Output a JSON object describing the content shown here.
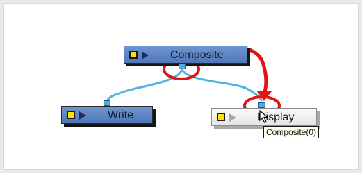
{
  "nodes": {
    "composite": {
      "label": "Composite"
    },
    "write": {
      "label": "Write"
    },
    "display": {
      "label": "Display"
    }
  },
  "tooltip": {
    "text": "Composite(0)"
  },
  "colors": {
    "node_blue": "#5b82c4",
    "node_light": "#f2f2f2",
    "wire": "#4fb3e3",
    "highlight": "#e31313",
    "chip": "#ffe100"
  },
  "icons": [
    "enable-chip-icon",
    "play-arrow-icon",
    "arrow-cursor-icon"
  ]
}
